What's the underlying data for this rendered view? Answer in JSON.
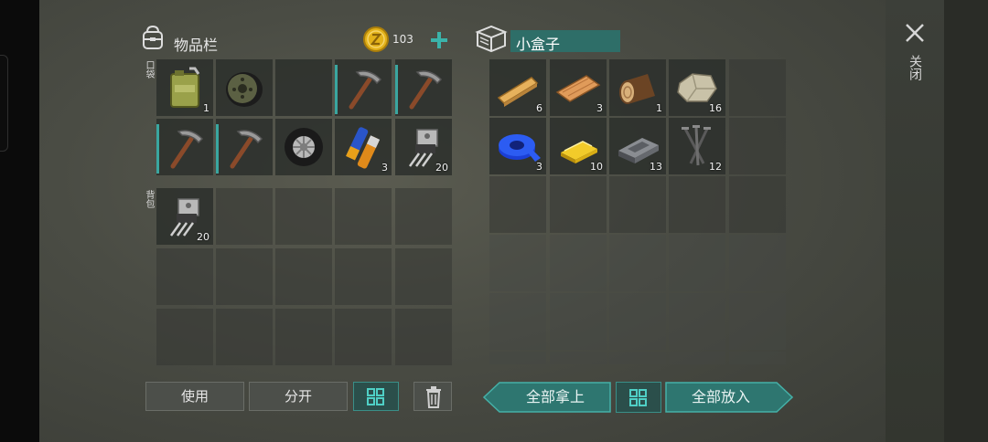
{
  "inventory": {
    "title": "物品栏",
    "coin_count": "103",
    "pocket_label": "口袋",
    "backpack_label": "背包",
    "pockets": [
      {
        "item": "fuel-can-icon",
        "count": "1"
      },
      {
        "item": "tire-rim-icon",
        "count": ""
      },
      {
        "item": "",
        "count": ""
      },
      {
        "item": "pickaxe-icon",
        "count": "",
        "bar": true
      },
      {
        "item": "pickaxe-icon",
        "count": "",
        "bar": true
      },
      {
        "item": "pickaxe-icon",
        "count": "",
        "bar": true
      },
      {
        "item": "pickaxe-icon",
        "count": "",
        "bar": true
      },
      {
        "item": "car-tire-icon",
        "count": ""
      },
      {
        "item": "batteries-icon",
        "count": "3"
      },
      {
        "item": "transistor-icon",
        "count": "20"
      }
    ],
    "backpack": [
      {
        "item": "transistor-icon",
        "count": "20"
      }
    ]
  },
  "container": {
    "title": "小盒子",
    "items": [
      {
        "item": "wood-plank-icon",
        "count": "6"
      },
      {
        "item": "wood-board-icon",
        "count": "3"
      },
      {
        "item": "log-icon",
        "count": "1"
      },
      {
        "item": "stone-icon",
        "count": "16"
      },
      {
        "item": "",
        "count": ""
      },
      {
        "item": "blue-tape-icon",
        "count": "3"
      },
      {
        "item": "gold-bar-icon",
        "count": "10"
      },
      {
        "item": "iron-bar-icon",
        "count": "13"
      },
      {
        "item": "nails-icon",
        "count": "12"
      },
      {
        "item": "",
        "count": ""
      }
    ]
  },
  "buttons": {
    "use": "使用",
    "split": "分开",
    "take_all": "全部拿上",
    "put_all": "全部放入",
    "close": "关闭"
  },
  "colors": {
    "accent": "#2e7670",
    "slot_bg": "#2c2f2b",
    "coin": "#e3b21a"
  }
}
